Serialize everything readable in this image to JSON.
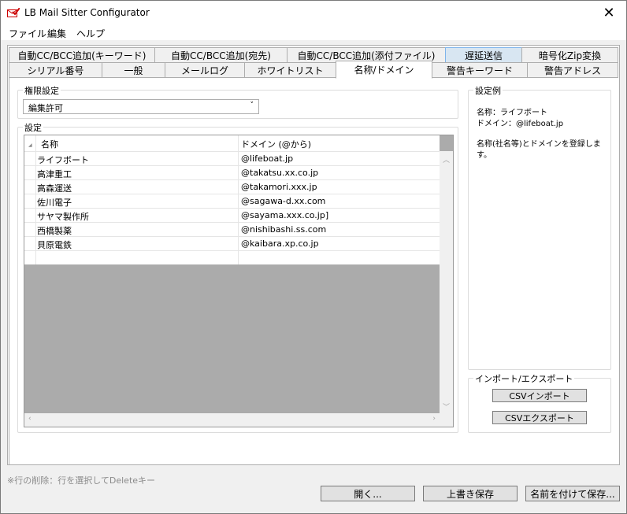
{
  "window": {
    "title": "LB Mail Sitter Configurator",
    "close": "✕"
  },
  "menu": [
    "ファイル",
    "編集",
    "ヘルプ"
  ],
  "tabs_top": [
    "自動CC/BCC追加(キーワード)",
    "自動CC/BCC追加(宛先)",
    "自動CC/BCC追加(添付ファイル)",
    "遅延送信",
    "暗号化Zip変換"
  ],
  "tabs_bottom": [
    "シリアル番号",
    "一般",
    "メールログ",
    "ホワイトリスト",
    "名称/ドメイン",
    "警告キーワード",
    "警告アドレス"
  ],
  "permission": {
    "legend": "権限設定",
    "value": "編集許可"
  },
  "settings": {
    "legend": "設定",
    "columns": [
      "名称",
      "ドメイン (@から)"
    ],
    "rows": [
      {
        "name": "ライフボート",
        "domain": "@lifeboat.jp"
      },
      {
        "name": "高津重工",
        "domain": "@takatsu.xx.co.jp"
      },
      {
        "name": "高森運送",
        "domain": "@takamori.xxx.jp"
      },
      {
        "name": "佐川電子",
        "domain": "@sagawa-d.xx.com"
      },
      {
        "name": "サヤマ製作所",
        "domain": "@sayama.xxx.co.jp]"
      },
      {
        "name": "西橋製薬",
        "domain": "@nishibashi.ss.com"
      },
      {
        "name": "貝原電鉄",
        "domain": "@kaibara.xp.co.jp"
      }
    ]
  },
  "example": {
    "legend": "設定例",
    "line1": "名称：ライフボート",
    "line2": "ドメイン：@lifeboat.jp",
    "line3": "名称(社名等)とドメインを登録します。"
  },
  "import_export": {
    "legend": "インポート/エクスポート",
    "import": "CSVインポート",
    "export": "CSVエクスポート"
  },
  "footer": {
    "hint": "※行の削除：行を選択してDeleteキー",
    "open": "開く...",
    "overwrite": "上書き保存",
    "save_as": "名前を付けて保存..."
  }
}
